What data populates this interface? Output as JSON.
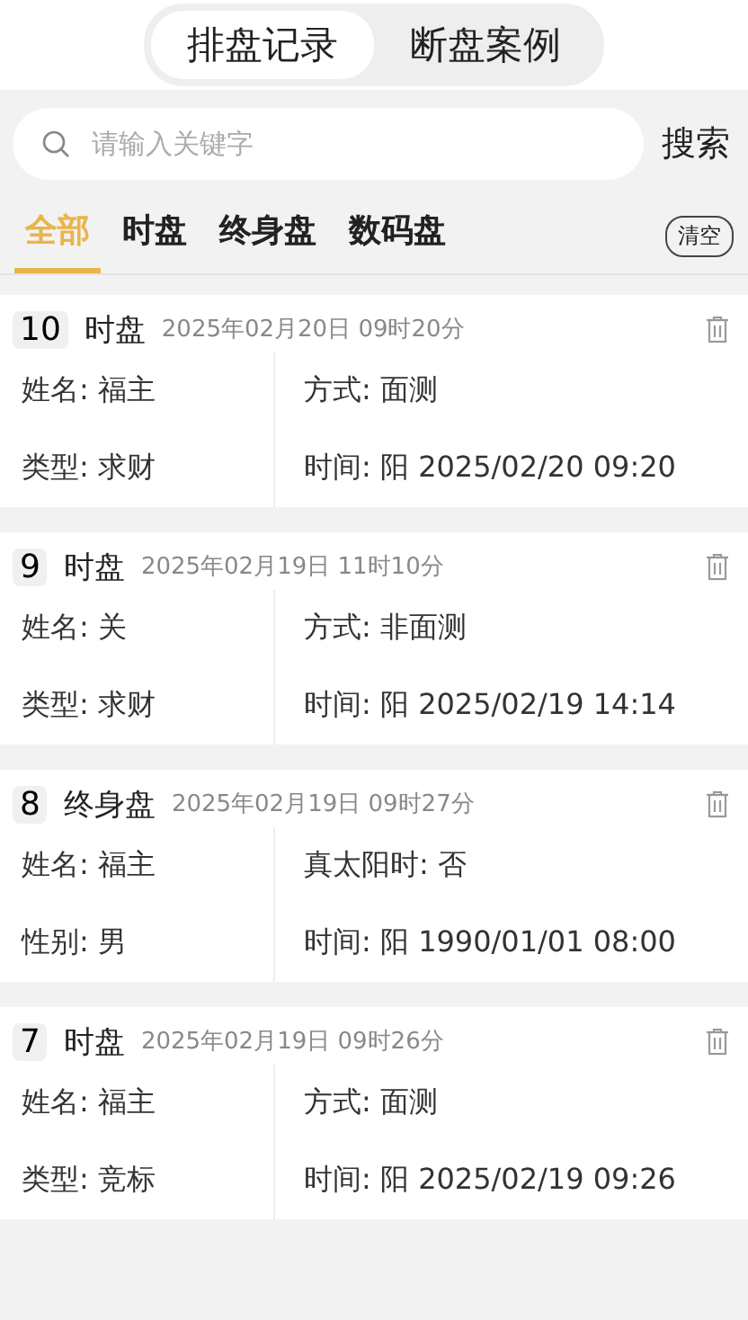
{
  "segments": [
    {
      "label": "排盘记录",
      "selected": true
    },
    {
      "label": "断盘案例",
      "selected": false
    }
  ],
  "search": {
    "placeholder": "请输入关键字",
    "button": "搜索"
  },
  "filters": [
    {
      "label": "全部",
      "selected": true
    },
    {
      "label": "时盘",
      "selected": false
    },
    {
      "label": "终身盘",
      "selected": false
    },
    {
      "label": "数码盘",
      "selected": false
    }
  ],
  "clear_button": "清空",
  "records": [
    {
      "index": "10",
      "type": "时盘",
      "created": "2025年02月20日 09时20分",
      "fields": [
        "姓名: 福主",
        "方式: 面测",
        "类型: 求财",
        "时间: 阳 2025/02/20 09:20"
      ]
    },
    {
      "index": "9",
      "type": "时盘",
      "created": "2025年02月19日 11时10分",
      "fields": [
        "姓名: 关",
        "方式: 非面测",
        "类型: 求财",
        "时间: 阳 2025/02/19 14:14"
      ]
    },
    {
      "index": "8",
      "type": "终身盘",
      "created": "2025年02月19日 09时27分",
      "fields": [
        "姓名: 福主",
        "真太阳时: 否",
        "性别: 男",
        "时间: 阳 1990/01/01 08:00"
      ]
    },
    {
      "index": "7",
      "type": "时盘",
      "created": "2025年02月19日 09时26分",
      "fields": [
        "姓名: 福主",
        "方式: 面测",
        "类型: 竞标",
        "时间: 阳 2025/02/19 09:26"
      ]
    }
  ]
}
